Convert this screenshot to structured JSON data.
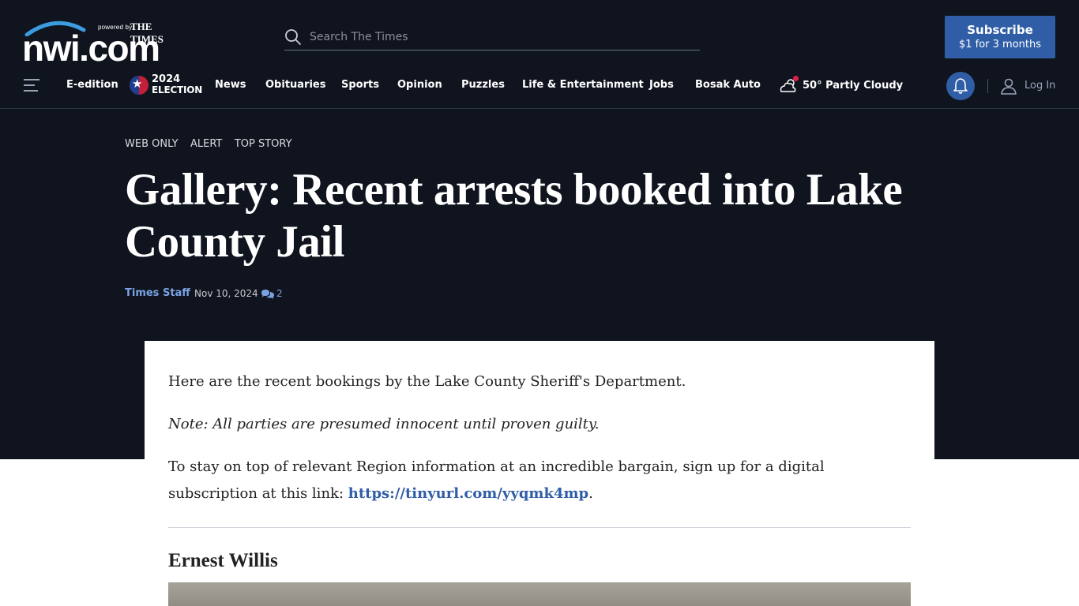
{
  "header": {
    "logo": {
      "brand": "nwi.com",
      "powered_by": "powered by",
      "times": "THE TIMES"
    },
    "search": {
      "placeholder": "Search The Times"
    },
    "subscribe": {
      "line1": "Subscribe",
      "line2": "$1 for 3 months"
    }
  },
  "nav": {
    "items": [
      {
        "label": "E-edition"
      },
      {
        "label": "News"
      },
      {
        "label": "Obituaries"
      },
      {
        "label": "Sports"
      },
      {
        "label": "Opinion"
      },
      {
        "label": "Puzzles"
      },
      {
        "label": "Life & Entertainment"
      },
      {
        "label": "Jobs"
      },
      {
        "label": "Bosak Auto"
      }
    ],
    "election": {
      "year": "2024",
      "label": "ELECTION"
    },
    "weather": {
      "text": "50° Partly Cloudy"
    },
    "login": "Log In"
  },
  "article": {
    "tags": [
      "WEB ONLY",
      "ALERT",
      "TOP STORY"
    ],
    "headline": "Gallery: Recent arrests booked into Lake County Jail",
    "author": "Times Staff",
    "date": "Nov 10, 2024",
    "comment_count": "2",
    "body": {
      "p1": "Here are the recent bookings by the Lake County Sheriff's Department.",
      "p2": "Note: All parties are presumed innocent until proven guilty.",
      "p3_text": "To stay on top of relevant Region information at an incredible bargain, sign up for a digital subscription at this link: ",
      "p3_link": "https://tinyurl.com/yyqmk4mp",
      "p3_end": ".",
      "subhead": "Ernest Willis"
    }
  },
  "colors": {
    "background_dark": "#0f141e",
    "accent_blue": "#2f5ea6",
    "link_blue": "#7aa2e3",
    "notification_red": "#e11d48"
  }
}
